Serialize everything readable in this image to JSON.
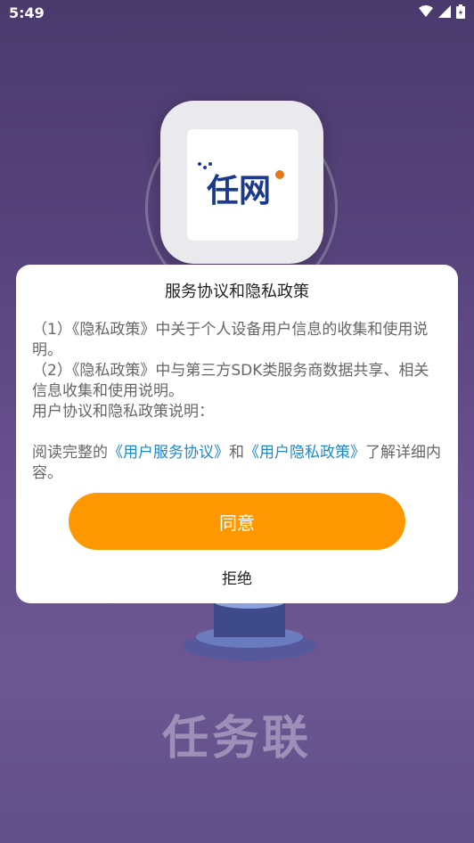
{
  "status_bar": {
    "time": "5:49"
  },
  "background": {
    "title": "任务联"
  },
  "app_logo": {
    "text": "任网"
  },
  "dialog": {
    "title": "服务协议和隐私政策",
    "paragraphs": [
      "（1）《隐私政策》中关于个人设备用户信息的收集和使用说明。",
      "（2）《隐私政策》中与第三方SDK类服务商数据共享、相关信息收集和使用说明。",
      "用户协议和隐私政策说明："
    ],
    "read_prefix": "阅读完整的",
    "link_service": "《用户服务协议》",
    "read_and": "和",
    "link_privacy": "《用户隐私政策》",
    "read_suffix": "了解详细内容。",
    "agree_label": "同意",
    "reject_label": "拒绝"
  },
  "colors": {
    "accent": "#ff9800",
    "link": "#1e88c9"
  }
}
